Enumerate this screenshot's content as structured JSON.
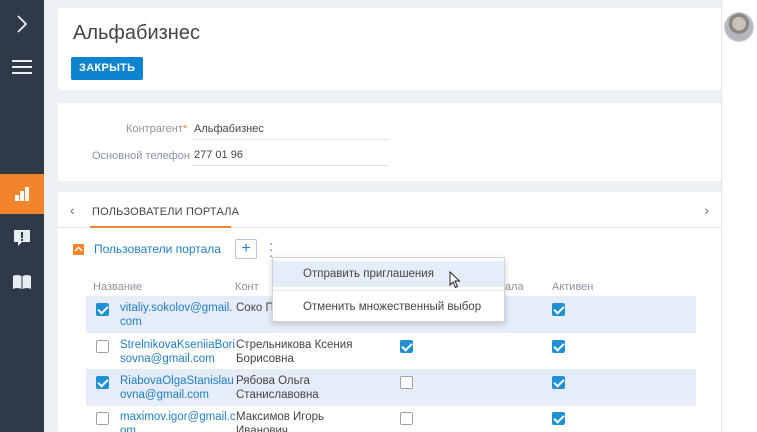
{
  "header": {
    "title": "Альфабизнес",
    "close_label": "ЗАКРЫТЬ"
  },
  "profile": {
    "account_label": "Контрагент",
    "required_mark": "*",
    "account_value": "Альфабизнес",
    "phone_label": "Основной телефон",
    "phone_value": "277 01 96"
  },
  "tabs": {
    "active": "ПОЛЬЗОВАТЕЛИ ПОРТАЛА",
    "prev_icon": "‹",
    "next_icon": "›"
  },
  "detail": {
    "title": "Пользователи портала",
    "add_label": "+",
    "more_label": "⋮"
  },
  "table": {
    "columns": [
      "Название",
      "Конт",
      "тала",
      "Активен"
    ],
    "rows": [
      {
        "selected": true,
        "name": "vitaliy.sokolov@gmail.com",
        "contact": "Соко Петрович",
        "portal": true,
        "active": true
      },
      {
        "selected": false,
        "name": "StrelnikovaKseniiaBorisovna@gmail.com",
        "contact": "Стрельникова Ксения Борисовна",
        "portal": true,
        "active": true
      },
      {
        "selected": true,
        "name": "RiabovaOlgaStanislauovna@gmail.com",
        "contact": "Рябова Ольга Станиславовна",
        "portal": false,
        "active": true
      },
      {
        "selected": false,
        "name": "maximov.igor@gmail.com",
        "contact": "Максимов Игорь Иванович",
        "portal": false,
        "active": true
      }
    ]
  },
  "menu": {
    "items": [
      "Отправить приглашения",
      "Отменить множественный выбор"
    ]
  },
  "colors": {
    "accent": "#f4842b",
    "primary": "#0d84ce",
    "sidebar": "#2f3a49",
    "link": "#1f7ec5"
  }
}
